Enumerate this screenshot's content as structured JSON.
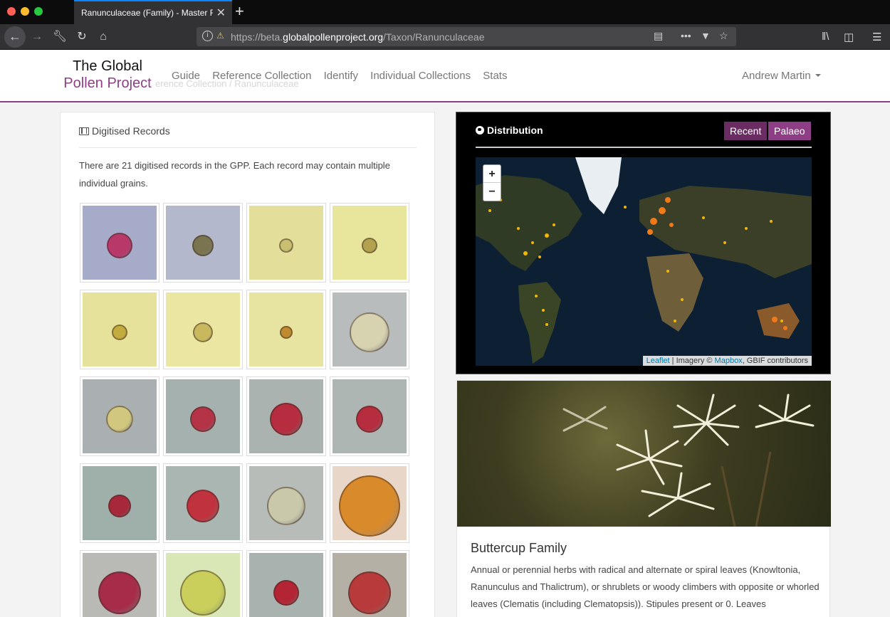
{
  "browser": {
    "tab_title": "Ranunculaceae (Family) - Master Re",
    "url_prefix": "https://beta.",
    "url_host": "globalpollenproject.org",
    "url_path": "/Taxon/Ranunculaceae",
    "new_tab": "+",
    "close": "✕"
  },
  "site": {
    "brand_line1": "The Global",
    "brand_line2": "Pollen Project",
    "ghost_breadcrumb": "erence Collection  /  Ranunculaceae",
    "nav": [
      "Guide",
      "Reference Collection",
      "Identify",
      "Individual Collections",
      "Stats"
    ],
    "user": "Andrew Martin",
    "brand_color": "#8e3e85"
  },
  "records": {
    "heading": "Digitised Records",
    "description": "There are 21 digitised records in the GPP. Each record may contain multiple individual grains.",
    "thumbnails": [
      {
        "bg": "#a6abc9",
        "grain": "#b8386a",
        "size": 36
      },
      {
        "bg": "#b4b8cd",
        "grain": "#7a7550",
        "size": 30
      },
      {
        "bg": "#e3df9a",
        "grain": "#c9bf70",
        "size": 20
      },
      {
        "bg": "#e8e59c",
        "grain": "#b2a250",
        "size": 22
      },
      {
        "bg": "#e6e29c",
        "grain": "#c4ab3e",
        "size": 22
      },
      {
        "bg": "#ebe6a2",
        "grain": "#c9b85d",
        "size": 28
      },
      {
        "bg": "#e7e3a0",
        "grain": "#c08a2e",
        "size": 18
      },
      {
        "bg": "#b9bcbc",
        "grain": "#d7d2b0",
        "size": 56
      },
      {
        "bg": "#aab0b2",
        "grain": "#d1c77e",
        "size": 38
      },
      {
        "bg": "#a5b1ae",
        "grain": "#b53346",
        "size": 36
      },
      {
        "bg": "#aab3b0",
        "grain": "#b52d3e",
        "size": 46
      },
      {
        "bg": "#aeb6b4",
        "grain": "#b52d3e",
        "size": 38
      },
      {
        "bg": "#9fafa9",
        "grain": "#a8283b",
        "size": 32
      },
      {
        "bg": "#a9b6b2",
        "grain": "#c0323e",
        "size": 46
      },
      {
        "bg": "#b8bcb9",
        "grain": "#cac8aa",
        "size": 54
      },
      {
        "bg": "#e8d7c8",
        "grain": "#d98a2a",
        "size": 86
      },
      {
        "bg": "#b9bab6",
        "grain": "#a62c4a",
        "size": 60
      },
      {
        "bg": "#d9e6b5",
        "grain": "#c9cf5a",
        "size": 64
      },
      {
        "bg": "#a8b2ae",
        "grain": "#b32434",
        "size": 36
      },
      {
        "bg": "#b5b0a6",
        "grain": "#b83a3a",
        "size": 60
      }
    ]
  },
  "distribution": {
    "heading": "Distribution",
    "toggle_recent": "Recent",
    "toggle_palaeo": "Palaeo",
    "zoom_in": "+",
    "zoom_out": "−",
    "attrib_leaflet": "Leaflet",
    "attrib_sep": " | Imagery © ",
    "attrib_mapbox": "Mapbox",
    "attrib_gbif": ", GBIF contributors"
  },
  "family": {
    "title": "Buttercup Family",
    "description": "Annual or perennial herbs with radical and alternate or spiral leaves (Knowltonia, Ranunculus and Thalictrum), or shrublets or woody climbers with opposite or whorled leaves (Clematis (including Clematopsis)). Stipules present or 0. Leaves"
  }
}
